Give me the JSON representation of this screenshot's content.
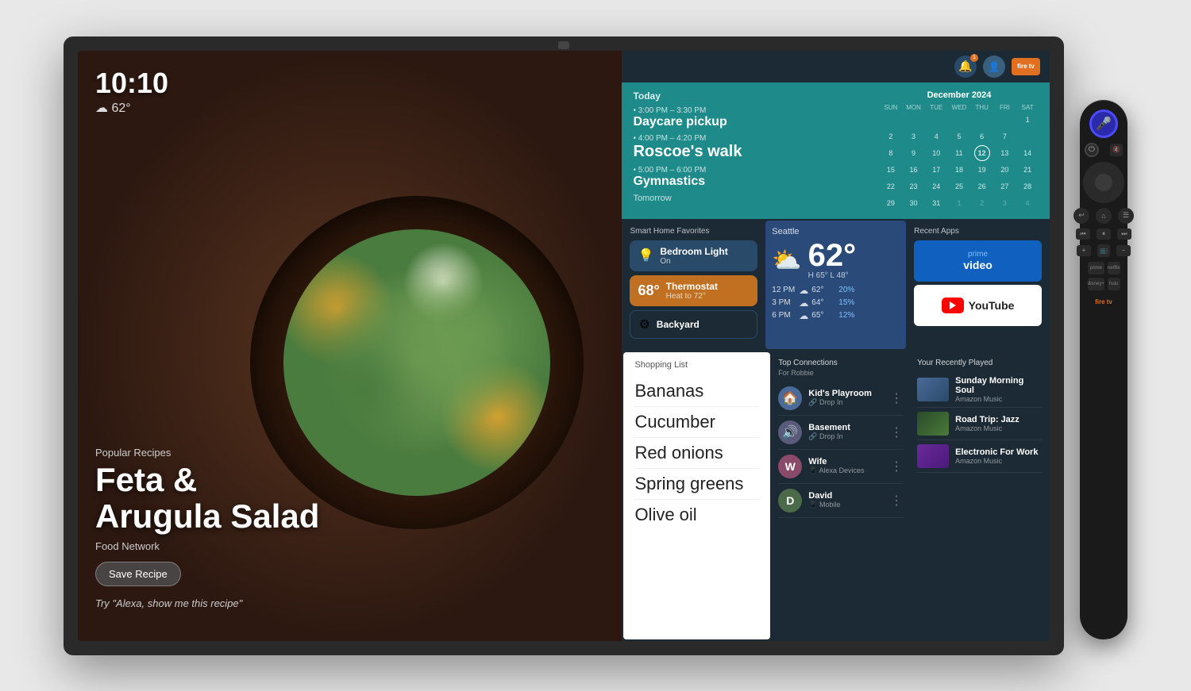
{
  "tv": {
    "left_panel": {
      "time": "10:10",
      "weather": "62°",
      "weather_icon": "☁",
      "popular_label": "Popular Recipes",
      "recipe_title_line1": "Feta &",
      "recipe_title_line2": "Arugula Salad",
      "food_network": "Food Network",
      "save_btn": "Save Recipe",
      "alexa_hint": "Try \"Alexa, show me this recipe\""
    },
    "header": {
      "notif_count": "1"
    },
    "today_section": {
      "today_label": "Today",
      "events": [
        {
          "time": "3:00 PM – 3:30 PM",
          "name": "Daycare pickup"
        },
        {
          "time": "4:00 PM – 4:20 PM",
          "name": "Roscoe's walk"
        },
        {
          "time": "5:00 PM – 6:00 PM",
          "name": "Gymnastics"
        }
      ],
      "tomorrow_label": "Tomorrow",
      "calendar": {
        "month": "December 2024",
        "day_names": [
          "SUN",
          "MON",
          "TUE",
          "WED",
          "THU",
          "FRI",
          "SAT"
        ],
        "weeks": [
          [
            null,
            null,
            null,
            null,
            null,
            null,
            "1"
          ],
          [
            "2",
            "3",
            "4",
            "5",
            "6",
            "7"
          ],
          [
            "8",
            "9",
            "10",
            "11",
            "12",
            "13",
            "14"
          ],
          [
            "15",
            "16",
            "17",
            "18",
            "19",
            "20",
            "21"
          ],
          [
            "22",
            "23",
            "24",
            "25",
            "26",
            "27",
            "28"
          ],
          [
            "29",
            "30",
            "31",
            null,
            null,
            null,
            null
          ]
        ],
        "today": "12"
      }
    },
    "smart_home": {
      "title": "Smart Home Favorites",
      "devices": [
        {
          "name": "Bedroom Light",
          "status": "On",
          "icon": "💡",
          "type": "light"
        },
        {
          "name": "Thermostat",
          "status": "Heat to 72°",
          "extra": "68°",
          "icon": "🌡",
          "type": "thermo"
        },
        {
          "name": "Backyard",
          "status": "",
          "icon": "⚙",
          "type": "backyard"
        }
      ]
    },
    "weather": {
      "location": "Seattle",
      "temp": "62°",
      "high": "65°",
      "low": "48°",
      "icon": "⛅",
      "forecast": [
        {
          "time": "12 PM",
          "icon": "☁",
          "temp": "62°",
          "pct": "20%"
        },
        {
          "time": "3 PM",
          "icon": "☁",
          "temp": "64°",
          "pct": "15%"
        },
        {
          "time": "6 PM",
          "icon": "☁",
          "temp": "65°",
          "pct": "12%"
        }
      ]
    },
    "recent_apps": {
      "title": "Recent Apps",
      "apps": [
        {
          "name": "Prime Video",
          "type": "prime"
        },
        {
          "name": "YouTube",
          "type": "youtube"
        }
      ]
    },
    "shopping_list": {
      "title": "Shopping List",
      "items": [
        "Bananas",
        "Cucumber",
        "Red onions",
        "Spring greens",
        "Olive oil"
      ]
    },
    "connections": {
      "title": "Top Connections",
      "subtitle": "For Robbie",
      "items": [
        {
          "name": "Kid's Playroom",
          "status": "Drop In",
          "avatar_text": "🏠",
          "type": "kids"
        },
        {
          "name": "Basement",
          "status": "Drop In",
          "avatar_text": "🏚",
          "type": "basement"
        },
        {
          "name": "Wife",
          "status": "Alexa Devices",
          "avatar_text": "W",
          "type": "wife"
        },
        {
          "name": "David",
          "status": "Mobile",
          "avatar_text": "D",
          "type": "david"
        }
      ]
    },
    "recently_played": {
      "title": "Your Recently Played",
      "items": [
        {
          "name": "Sunday Morning Soul",
          "source": "Amazon Music",
          "thumb_type": "sunday"
        },
        {
          "name": "Road Trip: Jazz",
          "source": "Amazon Music",
          "thumb_type": "road"
        },
        {
          "name": "Electronic For Work",
          "source": "Amazon Music",
          "thumb_type": "electronic"
        }
      ]
    }
  }
}
